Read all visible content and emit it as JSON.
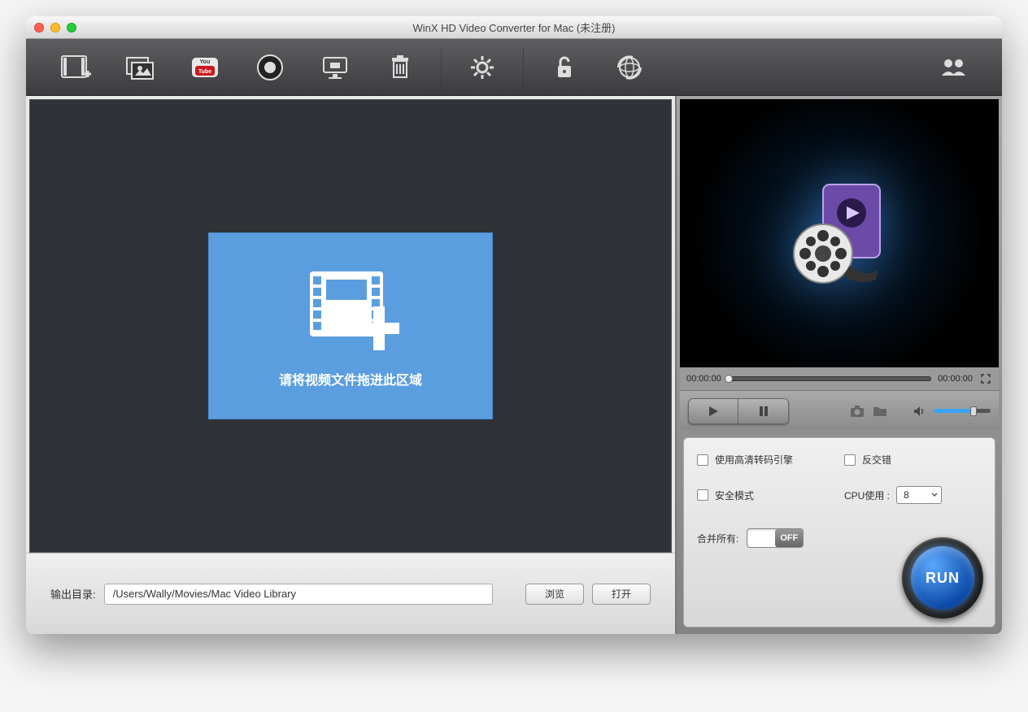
{
  "window_title": "WinX HD Video Converter for Mac (未注册)",
  "toolbar_icons": {
    "add_video": "add-video-icon",
    "add_photo": "add-photo-icon",
    "youtube": "youtube-icon",
    "record_camera": "record-camera-icon",
    "record_screen": "record-screen-icon",
    "trash": "trash-icon",
    "settings": "settings-icon",
    "unlock": "unlock-icon",
    "web_update": "web-update-icon",
    "about": "about-icon"
  },
  "drop_area": {
    "hint": "请将视频文件拖进此区域"
  },
  "output": {
    "label": "输出目录:",
    "path": "/Users/Wally/Movies/Mac Video Library",
    "browse": "浏览",
    "open": "打开"
  },
  "preview": {
    "time_start": "00:00:00",
    "time_end": "00:00:00"
  },
  "options": {
    "hd_engine": "使用高清转码引擎",
    "deinterlace": "反交错",
    "safe_mode": "安全模式",
    "cpu_label": "CPU使用 :",
    "cpu_value": "8",
    "merge_label": "合并所有:",
    "merge_state": "OFF"
  },
  "run_label": "RUN"
}
